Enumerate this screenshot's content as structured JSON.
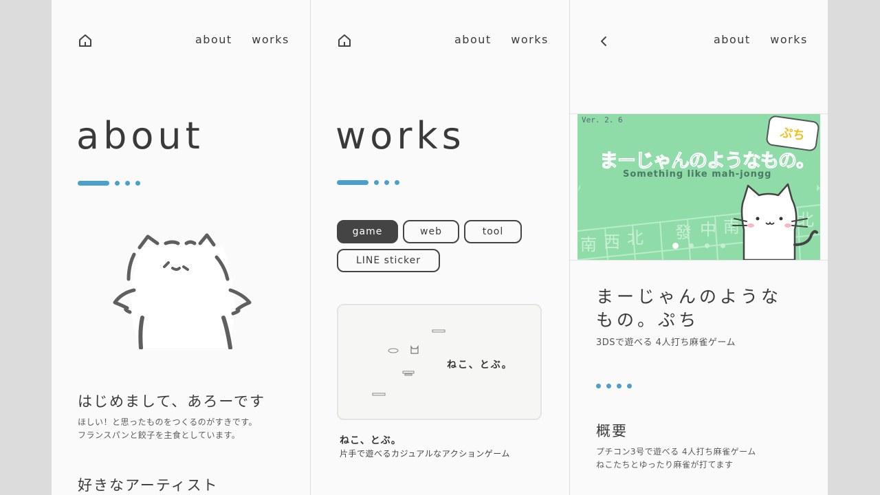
{
  "panels": {
    "about": {
      "nav": {
        "about": "about",
        "works": "works"
      },
      "title": "about",
      "intro_heading": "はじめまして、あろーです",
      "intro_line1": "ほしい！と思ったものをつくるのがすきです。",
      "intro_line2": "フランスパンと餃子を主食としています。",
      "artists_heading": "好きなアーティスト"
    },
    "works": {
      "nav": {
        "about": "about",
        "works": "works"
      },
      "title": "works",
      "filters": [
        "game",
        "web",
        "tool",
        "LINE sticker"
      ],
      "active_filter": "game",
      "card": {
        "thumb_text": "ねこ、とぶ。",
        "title": "ねこ、とぶ。",
        "description": "片手で遊べるカジュアルなアクションゲーム"
      }
    },
    "detail": {
      "nav": {
        "about": "about",
        "works": "works"
      },
      "slide": {
        "version": "Ver. 2. 6",
        "badge": "ぷち",
        "logo": "まーじゃんのようなもの。",
        "subtitle": "Something like mah-jongg",
        "tiles": [
          "南",
          "西",
          "北",
          "發",
          "中",
          "南",
          "北"
        ],
        "dot_count": 4,
        "active_dot": 0
      },
      "title_line1": "まーじゃんのような",
      "title_line2": "もの。ぷち",
      "subtitle": "3DSで遊べる 4人打ち麻雀ゲーム",
      "overview_heading": "概要",
      "overview_line1": "プチコン3号で遊べる 4人打ち麻雀ゲーム",
      "overview_line2": "ねこたちとゆったり麻雀が打てます"
    }
  },
  "colors": {
    "accent": "#4aa0cb",
    "text": "#3a3a3a",
    "panel_bg": "#fafafa",
    "slide_green": "#8fdca8"
  }
}
